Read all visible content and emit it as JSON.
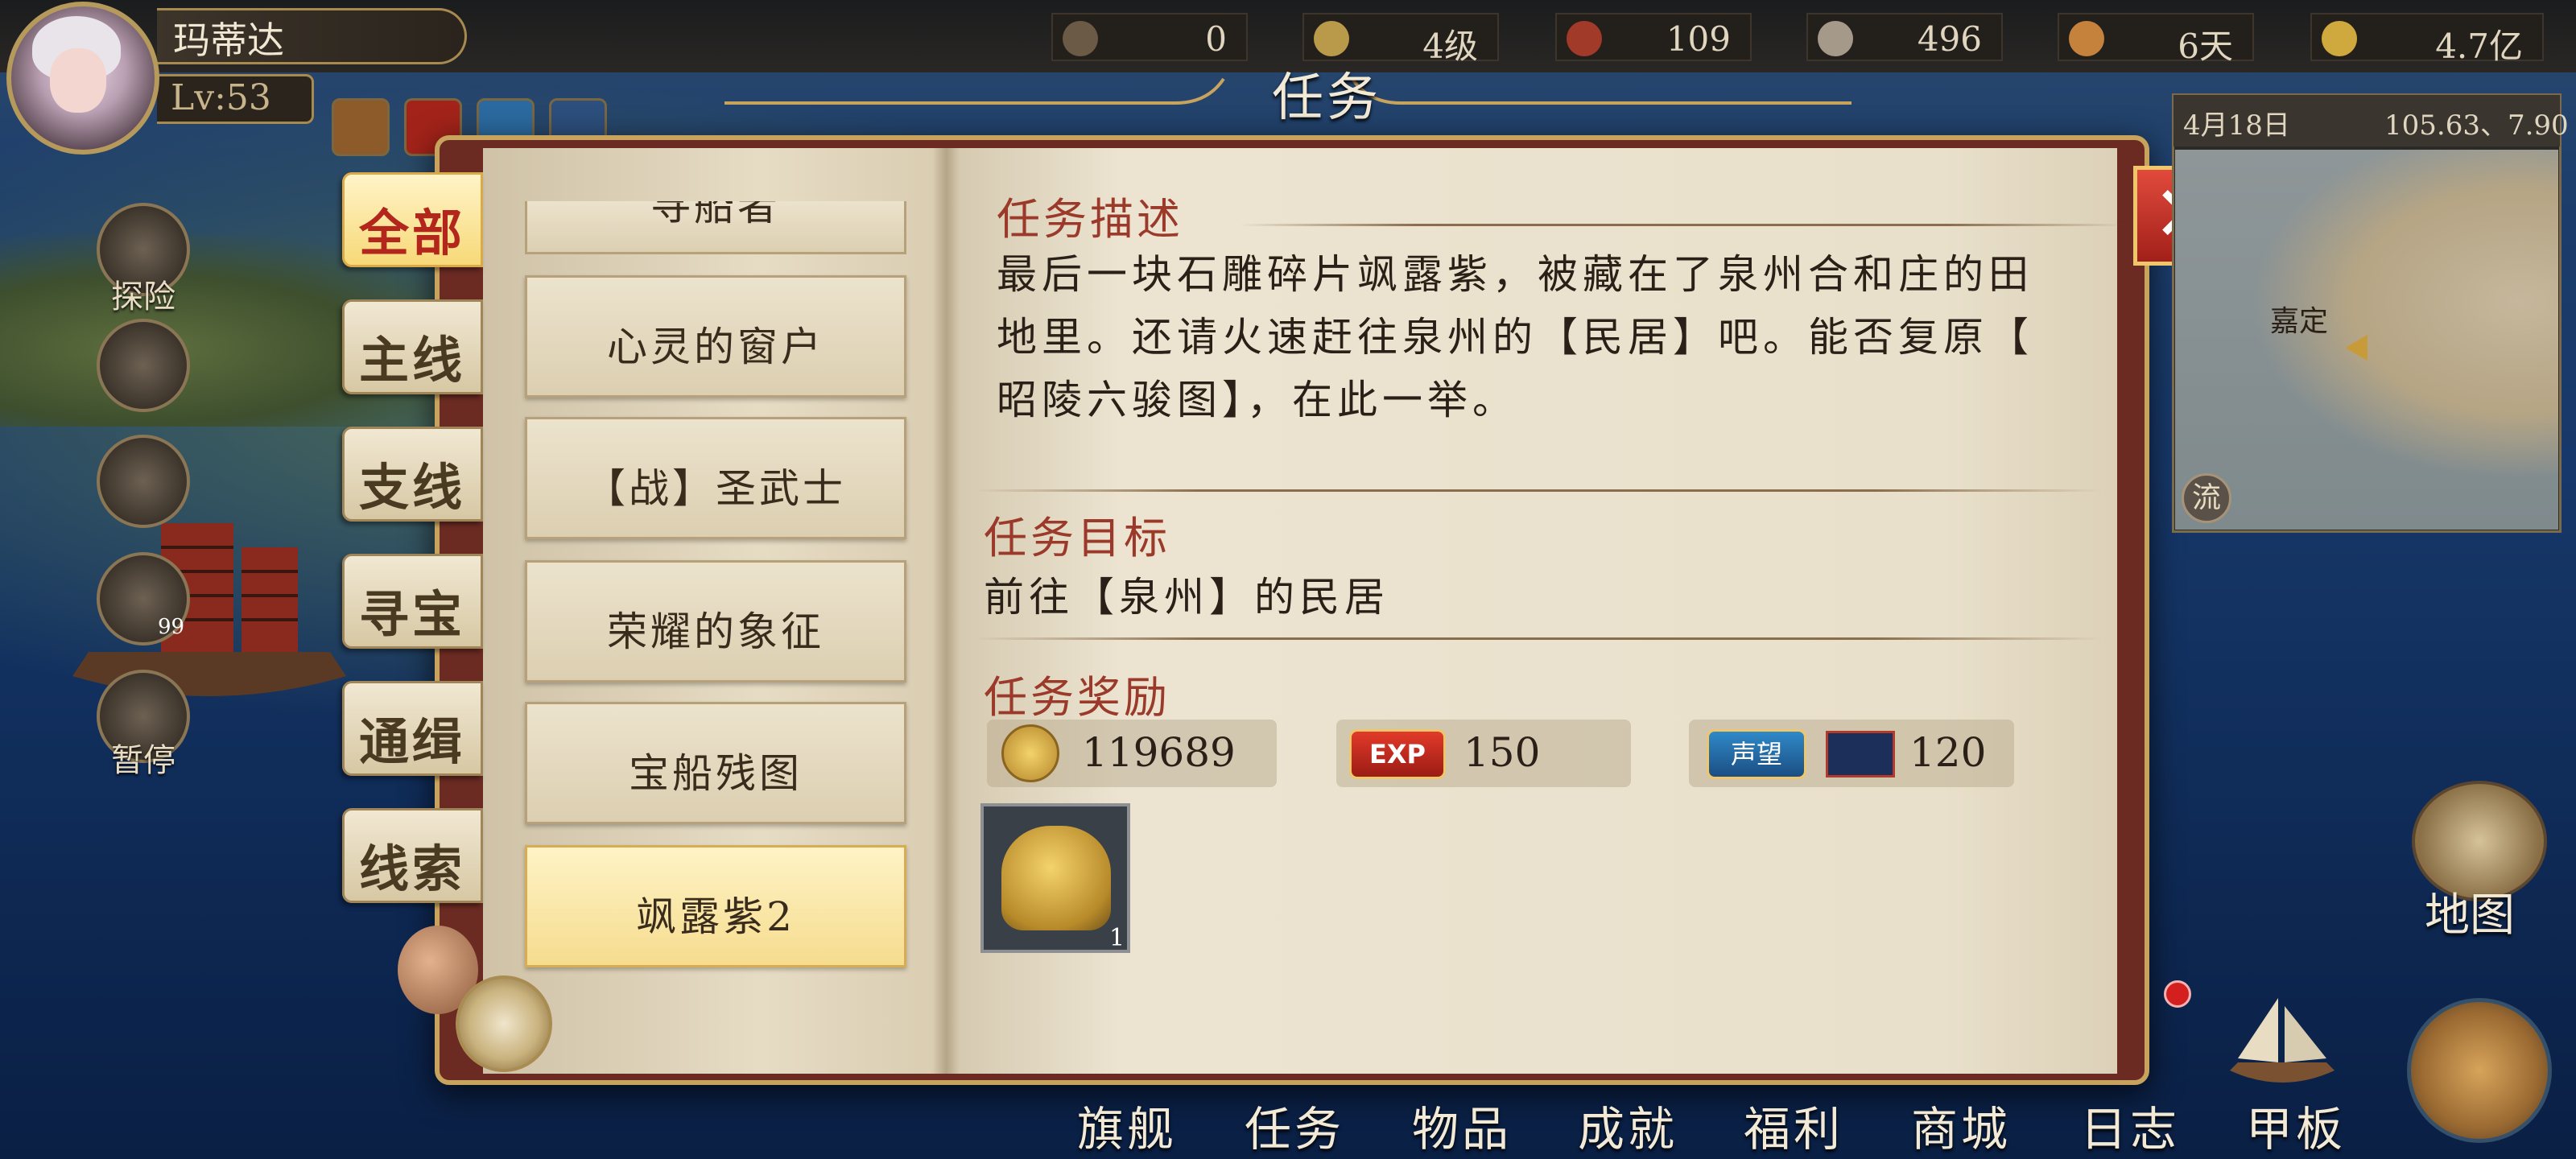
{
  "player": {
    "name": "玛蒂达",
    "level": "Lv:53"
  },
  "resources": [
    {
      "icon": "boot-icon",
      "value": "0"
    },
    {
      "icon": "rank-wings-icon",
      "value": "4级"
    },
    {
      "icon": "fleet-ship-icon",
      "value": "109"
    },
    {
      "icon": "sailor-icon",
      "value": "496"
    },
    {
      "icon": "bread-icon",
      "value": "6天"
    },
    {
      "icon": "gold-coin-icon",
      "value": "4.7亿"
    }
  ],
  "top_icons": [
    "gear-icon",
    "exp-icon",
    "reputation-icon",
    "hourglass-icon"
  ],
  "left_menu": [
    {
      "icon": "flag-icon",
      "label": "探险"
    },
    {
      "icon": "sail-icon",
      "label": ""
    },
    {
      "icon": "anchor-icon",
      "label": ""
    },
    {
      "icon": "hourglass-icon",
      "label": "",
      "badge": "99"
    },
    {
      "icon": "pause-icon",
      "label": "暂停"
    }
  ],
  "dialog": {
    "title": "任务",
    "categories": [
      {
        "label": "全部",
        "active": true
      },
      {
        "label": "主线",
        "active": false
      },
      {
        "label": "支线",
        "active": false
      },
      {
        "label": "寻宝",
        "active": false
      },
      {
        "label": "通缉",
        "active": false
      },
      {
        "label": "线索",
        "active": false
      }
    ],
    "quest_partial": "寻船者",
    "quests": [
      {
        "label": "心灵的窗户",
        "active": false
      },
      {
        "label": "【战】圣武士",
        "active": false
      },
      {
        "label": "荣耀的象征",
        "active": false
      },
      {
        "label": "宝船残图",
        "active": false
      },
      {
        "label": "飒露紫2",
        "active": true
      }
    ],
    "desc_heading": "任务描述",
    "desc_lines": [
      "最后一块石雕碎片飒露紫，被藏在了泉州合和庄的田",
      "地里。还请火速赶往泉州的【民居】吧。能否复原【",
      "昭陵六骏图】，在此一举。"
    ],
    "goal_heading": "任务目标",
    "goal_text": "前往【泉州】的民居",
    "reward_heading": "任务奖励",
    "rewards": {
      "gold": "119689",
      "exp_badge": "EXP",
      "exp": "150",
      "rep_badge": "声望",
      "reputation": "120"
    },
    "item_reward_count": "1"
  },
  "minimap": {
    "date": "4月18日",
    "coords": "105.63、7.90",
    "place": "嘉定",
    "flow_label": "流"
  },
  "map_button": "地图",
  "bottom_nav": [
    "旗舰",
    "任务",
    "物品",
    "成就",
    "福利",
    "商城",
    "日志",
    "甲板"
  ]
}
